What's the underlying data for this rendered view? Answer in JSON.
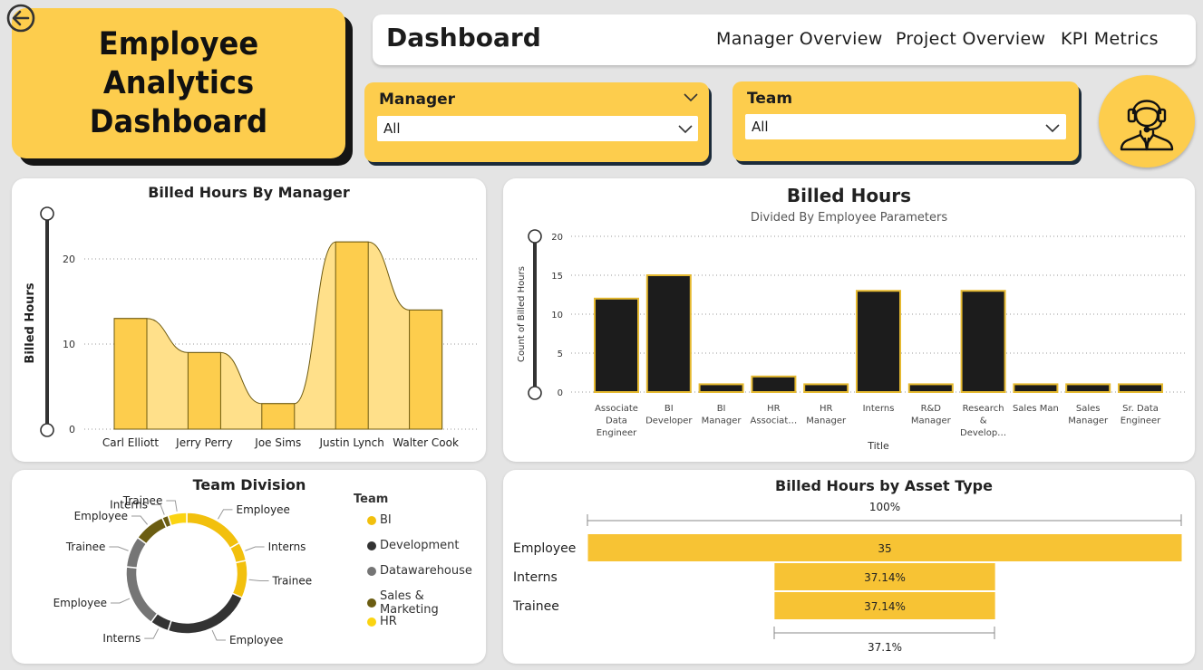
{
  "app": {
    "title_line1": "Employee Analytics",
    "title_line2": "Dashboard"
  },
  "nav": {
    "brand": "Dashboard",
    "links": [
      "Manager Overview",
      "Project Overview",
      "KPI Metrics"
    ]
  },
  "filters": {
    "manager": {
      "label": "Manager",
      "value": "All"
    },
    "team": {
      "label": "Team",
      "value": "All"
    }
  },
  "icons": {
    "back": "back-arrow-icon",
    "avatar": "support-agent-icon",
    "dropdown": "chevron-down-icon"
  },
  "colors": {
    "accent": "#fdcd4d",
    "dark": "#1c1c1c",
    "area_fill": "#ffe08a"
  },
  "chart_data": [
    {
      "id": "manager",
      "type": "bar",
      "title": "Billed Hours By Manager",
      "xlabel": "",
      "ylabel": "Billed Hours",
      "categories": [
        "Carl Elliott",
        "Jerry Perry",
        "Joe Sims",
        "Justin Lynch",
        "Walter Cook"
      ],
      "values": [
        13,
        9,
        3,
        22,
        14
      ],
      "ylim": [
        0,
        25
      ],
      "yticks": [
        "0",
        "10",
        "20"
      ],
      "grid": true
    },
    {
      "id": "billed",
      "type": "bar",
      "title": "Billed Hours",
      "subtitle": "Divided By Employee Parameters",
      "xlabel": "Title",
      "ylabel": "Count of Billed Hours",
      "categories": [
        [
          "Associate",
          "Data",
          "Engineer"
        ],
        [
          "BI",
          "Developer"
        ],
        [
          "BI",
          "Manager"
        ],
        [
          "HR",
          "Associat…"
        ],
        [
          "HR",
          "Manager"
        ],
        [
          "Interns"
        ],
        [
          "R&D",
          "Manager"
        ],
        [
          "Research",
          "&",
          "Develop…"
        ],
        [
          "Sales Man"
        ],
        [
          "Sales",
          "Manager"
        ],
        [
          "Sr. Data",
          "Engineer"
        ]
      ],
      "values": [
        12,
        15,
        1,
        2,
        1,
        13,
        1,
        13,
        1,
        1,
        1
      ],
      "ylim": [
        0,
        20
      ],
      "yticks": [
        "0",
        "5",
        "10",
        "15",
        "20"
      ],
      "grid": true
    },
    {
      "id": "team",
      "type": "pie",
      "title": "Team Division",
      "legend_title": "Team",
      "legend": [
        {
          "name": "BI",
          "color": "#f2c00d"
        },
        {
          "name": "Development",
          "color": "#333333"
        },
        {
          "name": "Datawarehouse",
          "color": "#757575"
        },
        {
          "name": "Sales & Marketing",
          "color": "#6b5d12"
        },
        {
          "name": "HR",
          "color": "#fbd412"
        }
      ],
      "slices": [
        {
          "label": "Employee",
          "value": 10,
          "color": "#f2c00d"
        },
        {
          "label": "Interns",
          "value": 3,
          "color": "#f2c00d"
        },
        {
          "label": "Trainee",
          "value": 6,
          "color": "#f2c00d"
        },
        {
          "label": "Employee",
          "value": 14,
          "color": "#333333"
        },
        {
          "label": "Interns",
          "value": 3,
          "color": "#333333"
        },
        {
          "label": "Employee",
          "value": 10,
          "color": "#757575"
        },
        {
          "label": "Trainee",
          "value": 5,
          "color": "#757575"
        },
        {
          "label": "Employee",
          "value": 5,
          "color": "#6b5d12"
        },
        {
          "label": "Interns",
          "value": 1,
          "color": "#6b5d12"
        },
        {
          "label": "Trainee",
          "value": 3,
          "color": "#fbd412"
        }
      ]
    },
    {
      "id": "asset",
      "type": "bar",
      "title": "Billed Hours by Asset Type",
      "categories": [
        "Employee",
        "Interns",
        "Trainee"
      ],
      "values": [
        35,
        13,
        13
      ],
      "data_labels": [
        "35",
        "37.14%",
        "37.14%"
      ],
      "top_label": "100%",
      "bottom_label": "37.1%"
    }
  ]
}
